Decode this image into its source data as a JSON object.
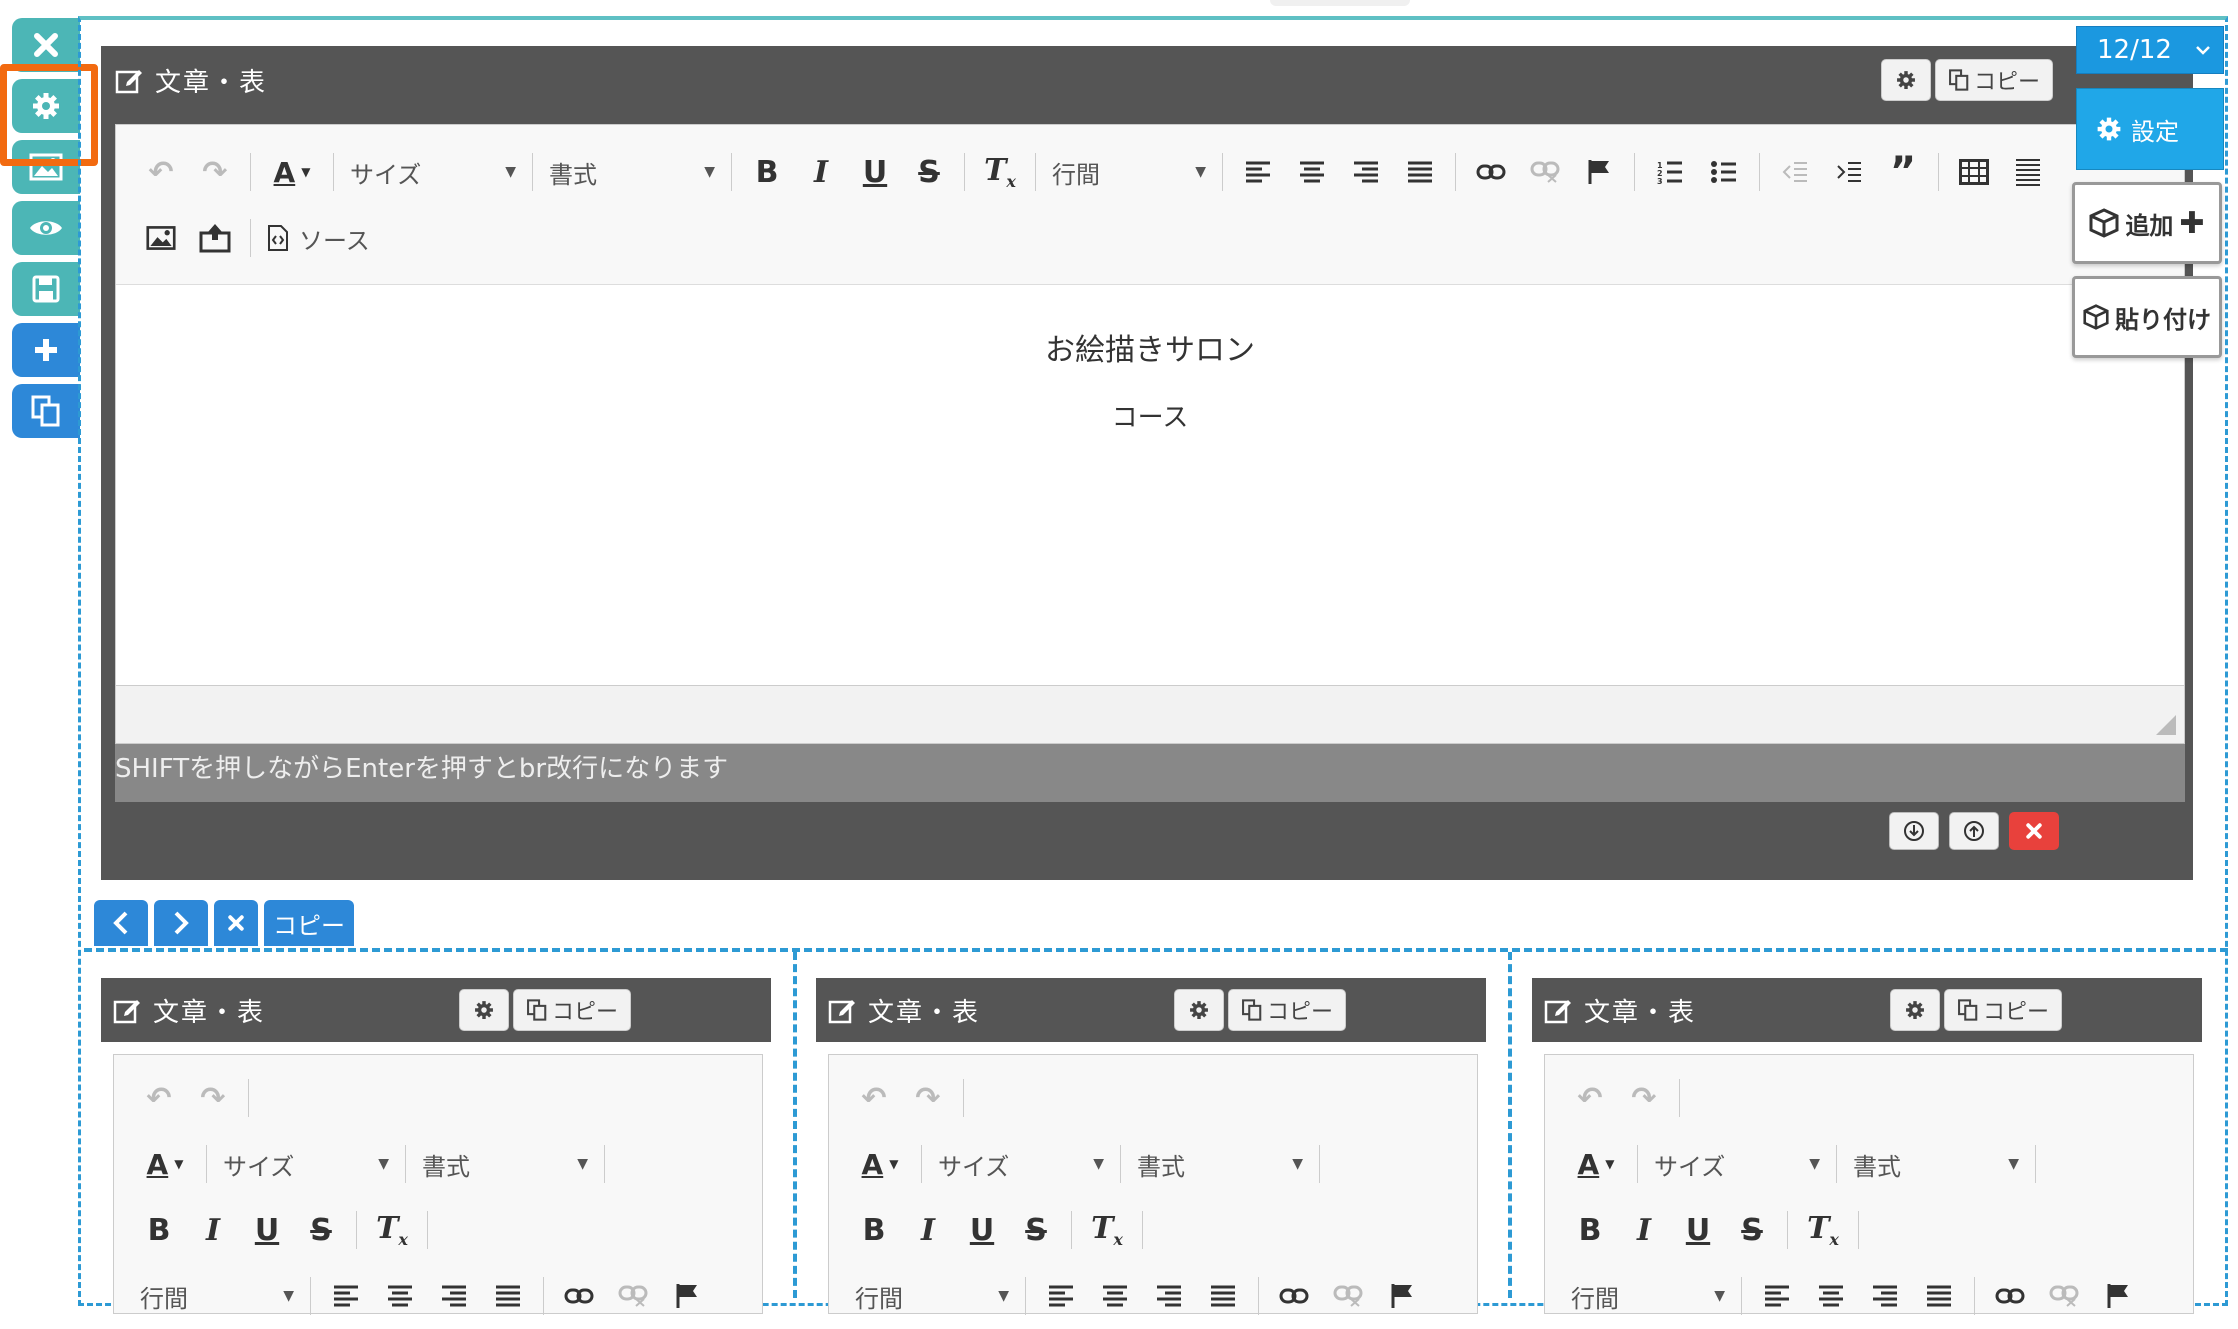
{
  "rail": {
    "buttons": [
      {
        "name": "close-icon",
        "color": "#4cb6b6"
      },
      {
        "name": "gear-icon",
        "color": "#4cb6b6"
      },
      {
        "name": "image-icon",
        "color": "#4cb6b6"
      },
      {
        "name": "eye-icon",
        "color": "#4cb6b6"
      },
      {
        "name": "save-icon",
        "color": "#4cb6b6"
      },
      {
        "name": "plus-icon",
        "color": "#2d88d8"
      },
      {
        "name": "copy-icon",
        "color": "#2d88d8"
      }
    ],
    "highlight_color": "#f26a10"
  },
  "main_panel": {
    "title": "文章・表",
    "copy_label": "コピー",
    "toolbar": {
      "size_label": "サイズ",
      "format_label": "書式",
      "line_spacing_label": "行間",
      "source_label": "ソース"
    },
    "content": {
      "line1": "お絵描きサロン",
      "line2": "コース"
    },
    "hint": "SHIFTを押しながらEnterを押すとbr改行になります"
  },
  "right": {
    "counter": "12/12",
    "settings_label": "設定",
    "add_label": "追加",
    "paste_label": "貼り付け"
  },
  "nav": {
    "copy_label": "コピー"
  },
  "columns": [
    {
      "title": "文章・表",
      "copy_label": "コピー",
      "size_label": "サイズ",
      "format_label": "書式",
      "line_spacing_label": "行間"
    },
    {
      "title": "文章・表",
      "copy_label": "コピー",
      "size_label": "サイズ",
      "format_label": "書式",
      "line_spacing_label": "行間"
    },
    {
      "title": "文章・表",
      "copy_label": "コピー",
      "size_label": "サイズ",
      "format_label": "書式",
      "line_spacing_label": "行間"
    }
  ],
  "colors": {
    "accent": "#2d88d8",
    "teal": "#4cb6b6",
    "panel": "#555555",
    "danger": "#e8413c",
    "counter": "#1b98e0"
  }
}
